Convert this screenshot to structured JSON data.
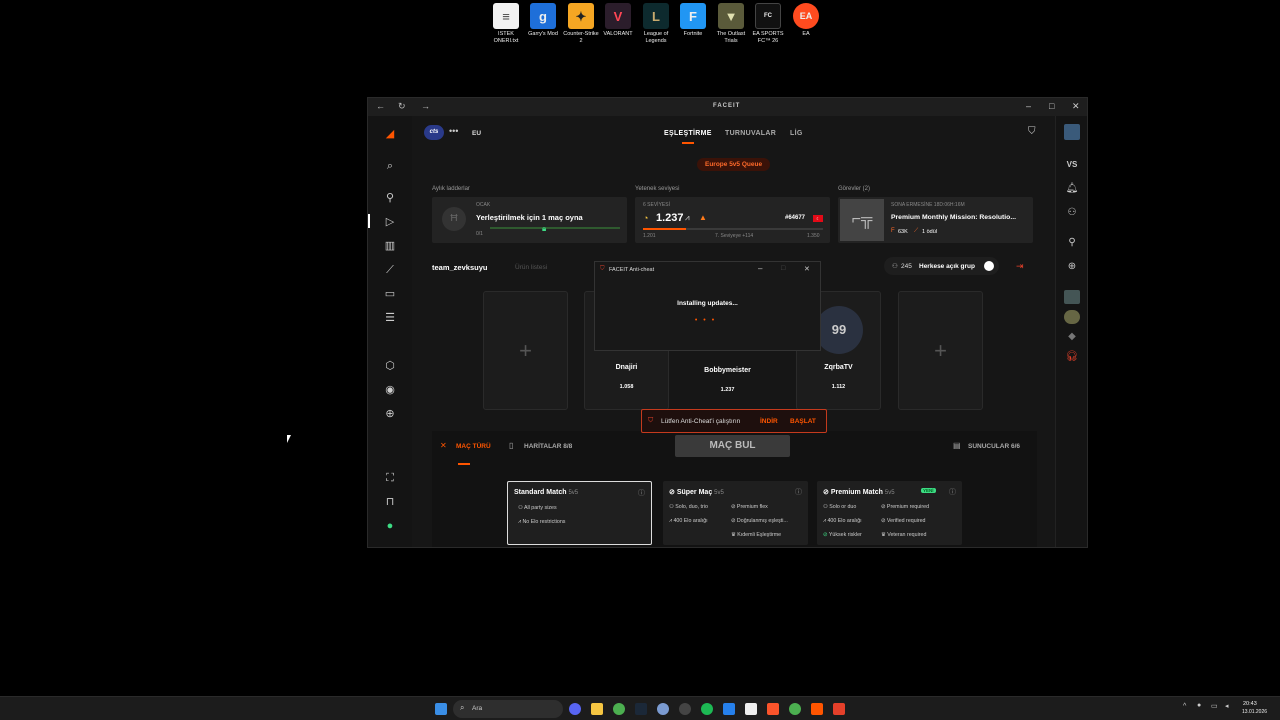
{
  "desktop_icons": [
    {
      "label": "ISTEK ONERI.txt",
      "color": "#ffffff"
    },
    {
      "label": "Garry's Mod",
      "color": "#1e6fd9"
    },
    {
      "label": "Counter-Strike 2",
      "color": "#f5a623"
    },
    {
      "label": "VALORANT",
      "color": "#ff4655"
    },
    {
      "label": "League of Legends",
      "color": "#c8aa6e"
    },
    {
      "label": "Fortnite",
      "color": "#2196f3"
    },
    {
      "label": "The Outlast Trials",
      "color": "#8a8a5a"
    },
    {
      "label": "EA SPORTS FC™ 26",
      "color": "#222222"
    },
    {
      "label": "EA",
      "color": "#ff4b1f"
    }
  ],
  "window": {
    "brand": "FACEIT",
    "region": "EU",
    "team_tag": "cts"
  },
  "nav": {
    "tabs": [
      "EŞLEŞTİRME",
      "TURNUVALAR",
      "LİG"
    ],
    "queue": "Europe 5v5 Queue"
  },
  "ladders": {
    "label": "Aylık ladderlar",
    "tier": "OCAK",
    "title": "Yerleştirilmek için 1 maç oyna",
    "progress": "0/1"
  },
  "skill": {
    "label": "Yetenek seviyesi",
    "level_text": "6 SEVİYESİ",
    "elo": "1.237",
    "rank": "#64677",
    "min": "1.201",
    "next": "7. Seviyeye +114",
    "max": "1.350",
    "progress_fraction": 0.24
  },
  "missions": {
    "label": "Görevler (2)",
    "timer": "SONA ERMESİNE 18D:06H:16M",
    "title": "Premium Monthly Mission: Resolutio...",
    "points": "63K",
    "reward": "1 ödül"
  },
  "team": {
    "name": "team_zevksuyu",
    "invite": "Ürün listesi",
    "members_count": "245",
    "group": "Herkese açık grup"
  },
  "players": [
    {
      "name": "Dnajiri",
      "elo": "1.058"
    },
    {
      "name": "Bobbymeister",
      "elo": "1.237"
    },
    {
      "name": "ZqrbaTV",
      "elo": "1.112"
    }
  ],
  "anticheat_dialog": {
    "title": "FACEIT Anti-cheat",
    "message": "Installing updates..."
  },
  "warning": {
    "text": "Lütfen Anti-Cheat'i çalıştırın",
    "download": "İNDİR",
    "start": "BAŞLAT"
  },
  "match": {
    "type": "MAÇ TÜRÜ",
    "maps": "HARİTALAR 8/8",
    "find": "MAÇ BUL",
    "servers": "SUNUCULAR 6/6"
  },
  "modes": [
    {
      "title": "Standard Match",
      "format": "5v5",
      "features": [
        "All party sizes",
        "No Elo restrictions"
      ]
    },
    {
      "title": "Süper Maç",
      "format": "5v5",
      "features": [
        "Solo, duo, trio",
        "400 Elo aralığı",
        "Premium flex",
        "Doğrulanmış eşleşti...",
        "Kıdemli Eşleştirme"
      ]
    },
    {
      "title": "Premium Match",
      "format": "5v5",
      "badge": "YENİ",
      "features": [
        "Solo or duo",
        "400 Elo aralığı",
        "Yüksek riskler",
        "Premium required",
        "Verified required",
        "Veteran required"
      ]
    }
  ],
  "rightbar": {
    "vs": "VS"
  },
  "taskbar": {
    "search": "Ara",
    "time": "20:43",
    "date": "13.01.2026"
  }
}
